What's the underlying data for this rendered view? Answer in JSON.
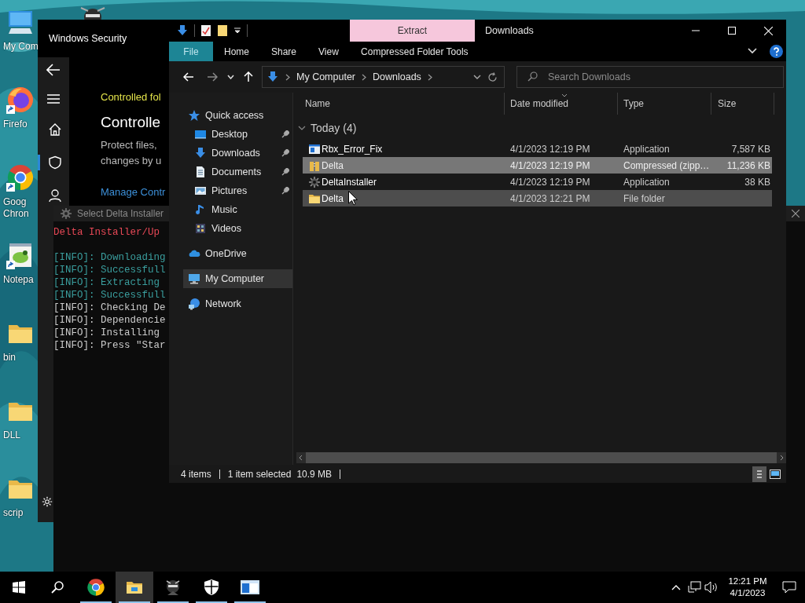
{
  "desktop_icons": [
    {
      "kind": "computer",
      "shortcut": false,
      "lines": [
        "My Com"
      ]
    },
    {
      "kind": "firefox",
      "shortcut": true,
      "lines": [
        "Firefo"
      ]
    },
    {
      "kind": "chrome",
      "shortcut": true,
      "lines": [
        "Goog",
        "Chron"
      ]
    },
    {
      "kind": "notepad",
      "shortcut": true,
      "lines": [
        "Notepa"
      ]
    },
    {
      "kind": "folder",
      "shortcut": false,
      "lines": [
        "bin"
      ]
    },
    {
      "kind": "folder",
      "shortcut": false,
      "lines": [
        "DLL"
      ]
    },
    {
      "kind": "folder",
      "shortcut": false,
      "lines": [
        "scrip"
      ]
    }
  ],
  "security_window": {
    "title": "Windows Security",
    "toolbar": [
      {
        "kind": "back"
      },
      {
        "kind": "menu"
      }
    ],
    "nav": [
      {
        "kind": "home",
        "selected": false
      },
      {
        "kind": "shield",
        "selected": true
      },
      {
        "kind": "account",
        "selected": false
      },
      {
        "kind": "settings",
        "selected": false
      }
    ],
    "eyebrow": "Controlled fol",
    "heading": "Controlle",
    "description": [
      "Protect files,",
      "changes by u"
    ],
    "link": "Manage Contr"
  },
  "console_window": {
    "title": "Select Delta Installer",
    "header": {
      "text": "Delta Installer/Up",
      "color": "#e74856"
    },
    "lines": [
      {
        "text": "[INFO]: Downloading",
        "color": "#3a9e9e"
      },
      {
        "text": "[INFO]: Successfull",
        "color": "#3a9e9e"
      },
      {
        "text": "[INFO]: Extracting",
        "color": "#3a9e9e"
      },
      {
        "text": "[INFO]: Successfull",
        "color": "#3a9e9e"
      },
      {
        "text": "[INFO]: Checking De",
        "color": "#cccccc"
      },
      {
        "text": "[INFO]: Dependencie",
        "color": "#cccccc"
      },
      {
        "text": "[INFO]: Installing",
        "color": "#cccccc"
      },
      {
        "text": "[INFO]: Press \"Star",
        "color": "#cccccc"
      }
    ]
  },
  "explorer": {
    "title": "Downloads",
    "context_tab": "Extract",
    "tabs": [
      {
        "label": "File",
        "kind": "file"
      },
      {
        "label": "Home",
        "kind": "tab"
      },
      {
        "label": "Share",
        "kind": "tab"
      },
      {
        "label": "View",
        "kind": "tab"
      },
      {
        "label": "Compressed Folder Tools",
        "kind": "context"
      }
    ],
    "address": [
      "My Computer",
      "Downloads"
    ],
    "search": {
      "placeholder": "Search Downloads"
    },
    "nav": [
      {
        "label": "Quick access",
        "kind": "star",
        "selected": false,
        "children": [
          {
            "label": "Desktop",
            "kind": "desktop",
            "pinned": true,
            "selected": false
          },
          {
            "label": "Downloads",
            "kind": "downloads",
            "pinned": true,
            "selected": false
          },
          {
            "label": "Documents",
            "kind": "documents",
            "pinned": true,
            "selected": false
          },
          {
            "label": "Pictures",
            "kind": "pictures",
            "pinned": true,
            "selected": false
          },
          {
            "label": "Music",
            "kind": "music",
            "pinned": false,
            "selected": false
          },
          {
            "label": "Videos",
            "kind": "videos",
            "pinned": false,
            "selected": false
          }
        ]
      },
      {
        "label": "OneDrive",
        "kind": "cloud",
        "selected": false
      },
      {
        "label": "My Computer",
        "kind": "computer",
        "selected": true
      },
      {
        "label": "Network",
        "kind": "network",
        "selected": false
      }
    ],
    "columns": [
      "Name",
      "Date modified",
      "Type",
      "Size"
    ],
    "group": {
      "label": "Today (4)",
      "expanded": true
    },
    "files": [
      {
        "name": "Rbx_Error_Fix",
        "kind": "app",
        "date": "4/1/2023 12:19 PM",
        "type": "Application",
        "size": "7,587 KB",
        "selected": false,
        "hovered": false
      },
      {
        "name": "Delta",
        "kind": "zip",
        "date": "4/1/2023 12:19 PM",
        "type": "Compressed (zipp…",
        "size": "11,236 KB",
        "selected": true,
        "hovered": false
      },
      {
        "name": "DeltaInstaller",
        "kind": "installer",
        "date": "4/1/2023 12:19 PM",
        "type": "Application",
        "size": "38 KB",
        "selected": false,
        "hovered": false
      },
      {
        "name": "Delta",
        "kind": "folder",
        "date": "4/1/2023 12:21 PM",
        "type": "File folder",
        "selected": false,
        "hovered": true
      }
    ],
    "status": {
      "count": "4 items",
      "selection": "1 item selected",
      "size": "10.9 MB"
    },
    "views": [
      {
        "kind": "details",
        "selected": true
      },
      {
        "kind": "tiles",
        "selected": false
      }
    ]
  },
  "taskbar": {
    "apps": [
      {
        "kind": "chrome",
        "running": true,
        "active": false
      },
      {
        "kind": "explorer",
        "running": true,
        "active": true
      },
      {
        "kind": "ninja",
        "running": true,
        "active": false
      },
      {
        "kind": "security",
        "running": true,
        "active": false
      },
      {
        "kind": "window",
        "running": true,
        "active": false
      }
    ],
    "time": "12:21 PM",
    "date": "4/1/2023"
  }
}
